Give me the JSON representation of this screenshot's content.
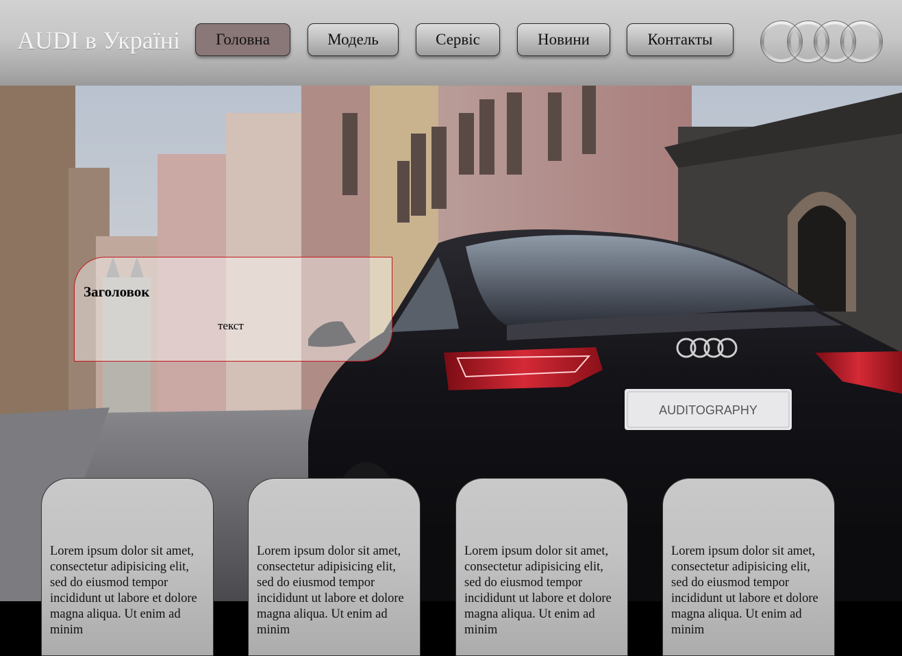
{
  "header": {
    "brand": "AUDI в Україні",
    "nav": [
      "Головна",
      "Модель",
      "Сервіс",
      "Новини",
      "Контакты"
    ],
    "active_index": 0,
    "logo": "audi-four-rings-logo"
  },
  "hero": {
    "background": "car-on-city-street-photo",
    "info": {
      "title": "Заголовок",
      "text": "текст"
    },
    "plate_text": "AUDITOGRAPHY"
  },
  "cards": [
    {
      "text": "Lorem ipsum dolor sit amet, consectetur adipisicing elit, sed do eiusmod tempor incididunt ut labore et dolore magna aliqua. Ut enim ad minim"
    },
    {
      "text": "Lorem ipsum dolor sit amet, consectetur adipisicing elit, sed do eiusmod tempor incididunt ut labore et dolore magna aliqua. Ut enim ad minim"
    },
    {
      "text": "Lorem ipsum dolor sit amet, consectetur adipisicing elit, sed do eiusmod tempor incididunt ut labore et dolore magna aliqua. Ut enim ad minim"
    },
    {
      "text": "Lorem ipsum dolor sit amet, consectetur adipisicing elit, sed do eiusmod tempor incididunt ut labore et dolore magna aliqua. Ut enim ad minim"
    }
  ],
  "colors": {
    "active_nav": "#8a7777",
    "info_border": "#c0181e",
    "taillight": "#c0182a"
  }
}
